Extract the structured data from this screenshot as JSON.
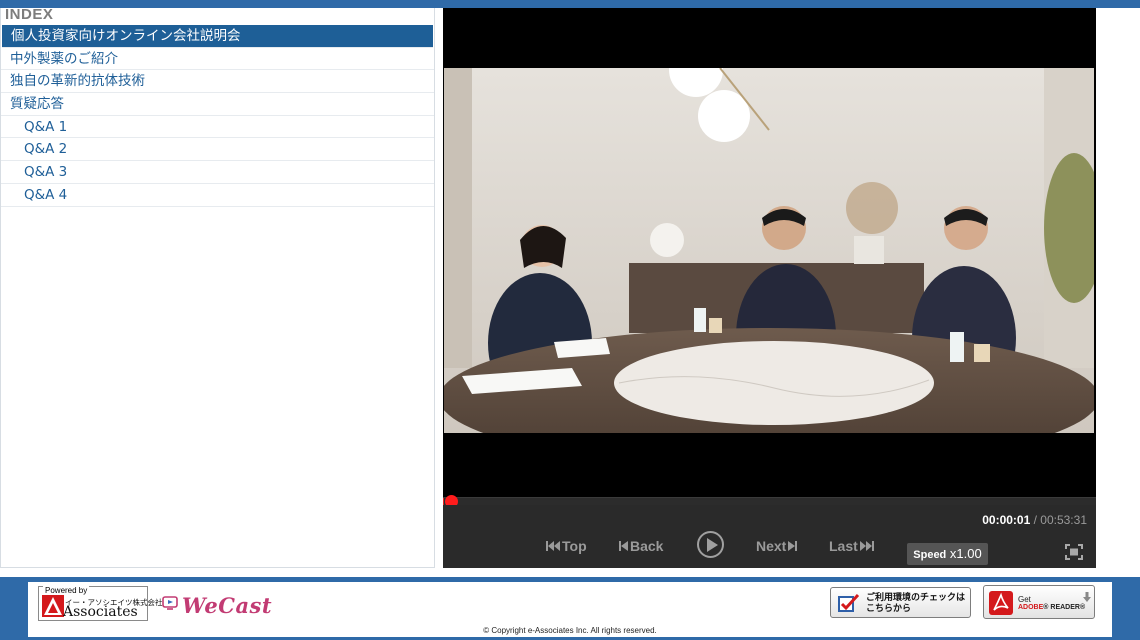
{
  "sidebar": {
    "header": "INDEX",
    "items": [
      {
        "label": "個人投資家向けオンライン会社説明会",
        "active": true,
        "sub": false
      },
      {
        "label": "中外製薬のご紹介",
        "active": false,
        "sub": false
      },
      {
        "label": "独自の革新的抗体技術",
        "active": false,
        "sub": false
      },
      {
        "label": "質疑応答",
        "active": false,
        "sub": false
      },
      {
        "label": "Q&A 1",
        "active": false,
        "sub": true
      },
      {
        "label": "Q&A 2",
        "active": false,
        "sub": true
      },
      {
        "label": "Q&A 3",
        "active": false,
        "sub": true
      },
      {
        "label": "Q&A 4",
        "active": false,
        "sub": true
      }
    ]
  },
  "player": {
    "progress": 0.0003,
    "time_current": "00:00:01",
    "time_separator": " / ",
    "time_total": "00:53:31",
    "controls": {
      "top_label": "Top",
      "back_label": "Back",
      "next_label": "Next",
      "last_label": "Last",
      "speed_label": "Speed",
      "speed_value": "x1.00"
    }
  },
  "footer": {
    "powered_by": "Powered by",
    "powered_sub": "イー・アソシエイツ株式会社",
    "powered_name": "Associates",
    "wecast": "WeCast",
    "check_text": "ご利用環境のチェックは こちらから",
    "adobe_get": "Get",
    "adobe_name_a": "ADOBE",
    "adobe_name_b": "® READER®",
    "copyright": "© Copyright e-Associates Inc. All rights reserved."
  },
  "colors": {
    "accent": "#1e5f97",
    "bar": "#2f6aa8",
    "progress": "#e52222"
  }
}
